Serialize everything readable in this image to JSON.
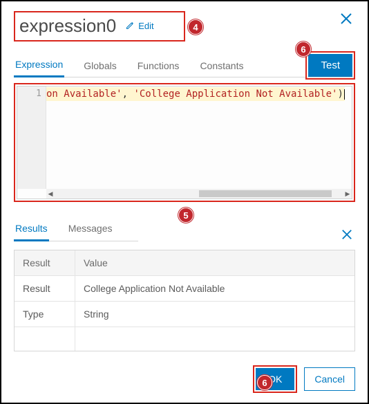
{
  "title": "expression0",
  "edit_label": "Edit",
  "tabs": {
    "expression": "Expression",
    "globals": "Globals",
    "functions": "Functions",
    "constants": "Constants"
  },
  "test_label": "Test",
  "code": {
    "line_number": "1",
    "frag1": "on Available'",
    "frag2": ", ",
    "frag3": "'College Application Not Available'",
    "frag4": ")"
  },
  "results_tabs": {
    "results": "Results",
    "messages": "Messages"
  },
  "results_table": {
    "header_result": "Result",
    "header_value": "Value",
    "rows": [
      {
        "key": "Result",
        "value": "College Application Not Available"
      },
      {
        "key": "Type",
        "value": "String"
      }
    ]
  },
  "footer": {
    "ok": "OK",
    "cancel": "Cancel"
  },
  "callouts": {
    "c4": "4",
    "c5": "5",
    "c6a": "6",
    "c6b": "6"
  }
}
